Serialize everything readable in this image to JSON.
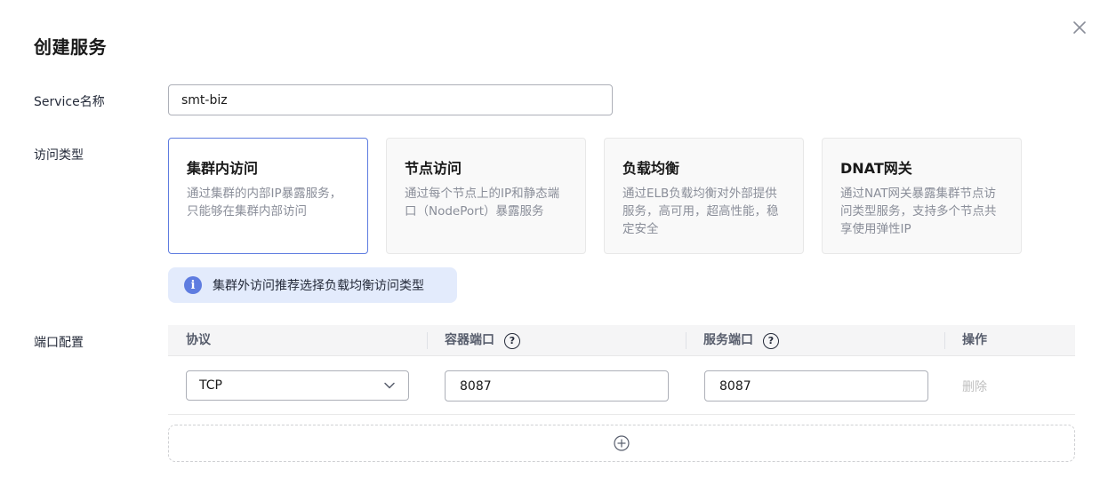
{
  "dialog": {
    "title": "创建服务"
  },
  "service_name": {
    "label": "Service名称",
    "value": "smt-biz"
  },
  "access_type": {
    "label": "访问类型",
    "selected_index": 0,
    "options": [
      {
        "title": "集群内访问",
        "description": "通过集群的内部IP暴露服务，只能够在集群内部访问"
      },
      {
        "title": "节点访问",
        "description": "通过每个节点上的IP和静态端口（NodePort）暴露服务"
      },
      {
        "title": "负载均衡",
        "description": "通过ELB负载均衡对外部提供服务，高可用，超高性能，稳定安全"
      },
      {
        "title": "DNAT网关",
        "description": "通过NAT网关暴露集群节点访问类型服务，支持多个节点共享使用弹性IP"
      }
    ],
    "tip": "集群外访问推荐选择负载均衡访问类型"
  },
  "port_config": {
    "label": "端口配置",
    "columns": {
      "protocol": "协议",
      "container_port": "容器端口",
      "service_port": "服务端口",
      "operation": "操作"
    },
    "rows": [
      {
        "protocol": "TCP",
        "container_port": "8087",
        "service_port": "8087",
        "delete_label": "删除"
      }
    ]
  },
  "colors": {
    "accent": "#5e7ce0",
    "tip_background": "#e3ebfc",
    "disabled_text": "#bfbfbf"
  },
  "icons": {
    "close": "close-icon",
    "info": "info-icon",
    "help": "help-circle-icon",
    "dropdown": "chevron-down-icon",
    "add": "add-circle-icon"
  }
}
